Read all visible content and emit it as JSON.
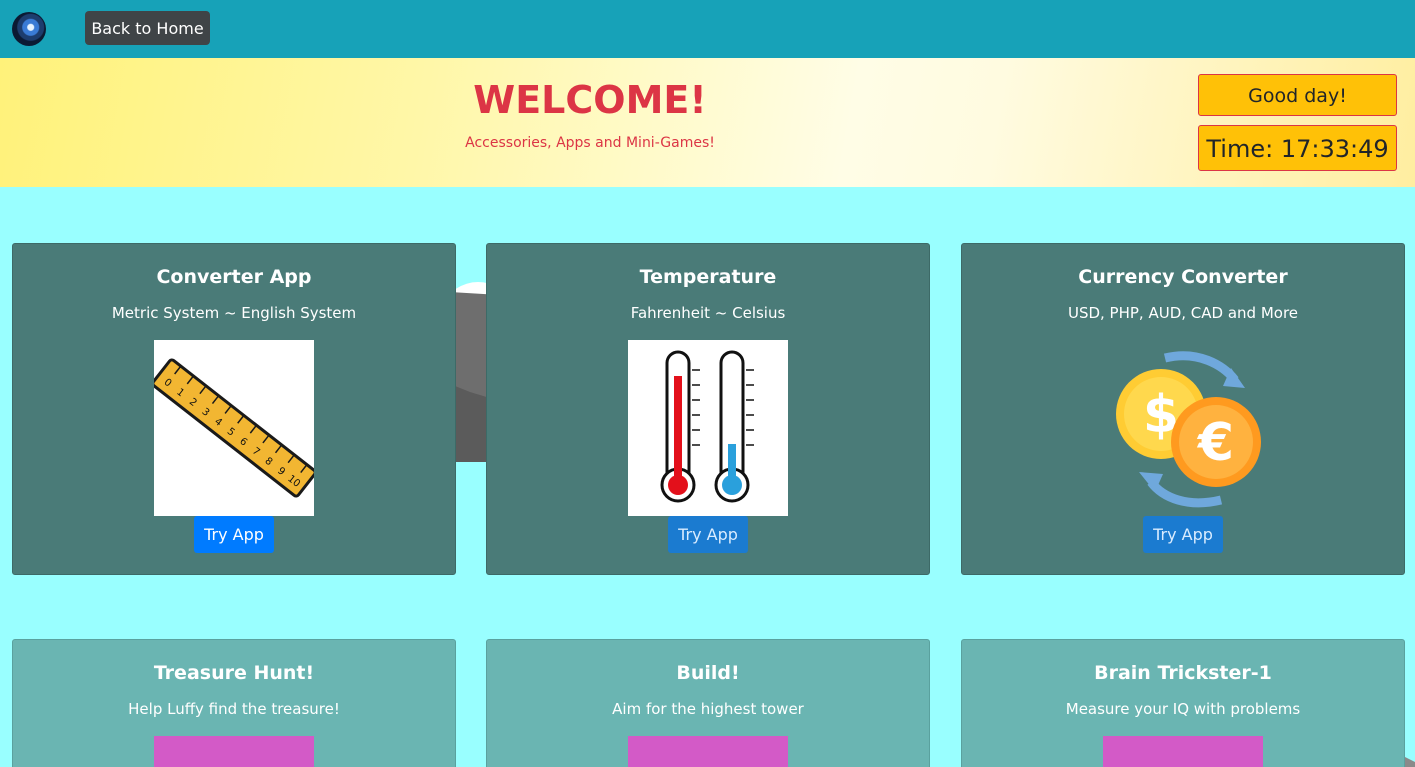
{
  "nav": {
    "back_label": "Back to Home"
  },
  "hero": {
    "title": "WELCOME!",
    "tagline": "Accessories, Apps and Mini-Games!",
    "greeting": "Good day!",
    "clock": "Time: 17:33:49"
  },
  "cards": [
    {
      "title": "Converter App",
      "subtitle": "Metric System ~ English System",
      "button": "Try App"
    },
    {
      "title": "Temperature",
      "subtitle": "Fahrenheit ~ Celsius",
      "button": "Try App"
    },
    {
      "title": "Currency Converter",
      "subtitle": "USD, PHP, AUD, CAD and More",
      "button": "Try App"
    },
    {
      "title": "Treasure Hunt!",
      "subtitle": "Help Luffy find the treasure!"
    },
    {
      "title": "Build!",
      "subtitle": "Aim for the highest tower"
    },
    {
      "title": "Brain Trickster-1",
      "subtitle": "Measure your IQ with problems"
    }
  ],
  "ruler_ticks": [
    "0",
    "1",
    "2",
    "3",
    "4",
    "5",
    "6",
    "7",
    "8",
    "9",
    "10"
  ],
  "colors": {
    "navbar": "#17a2b8",
    "page_bg": "#99ffff",
    "accent_red": "#dc3545",
    "badge_yellow": "#ffc107",
    "button_blue": "#007bff",
    "card_dark": "#4a7b78",
    "card_light": "#6ab5b2",
    "tile_pink": "#d35ac7"
  }
}
